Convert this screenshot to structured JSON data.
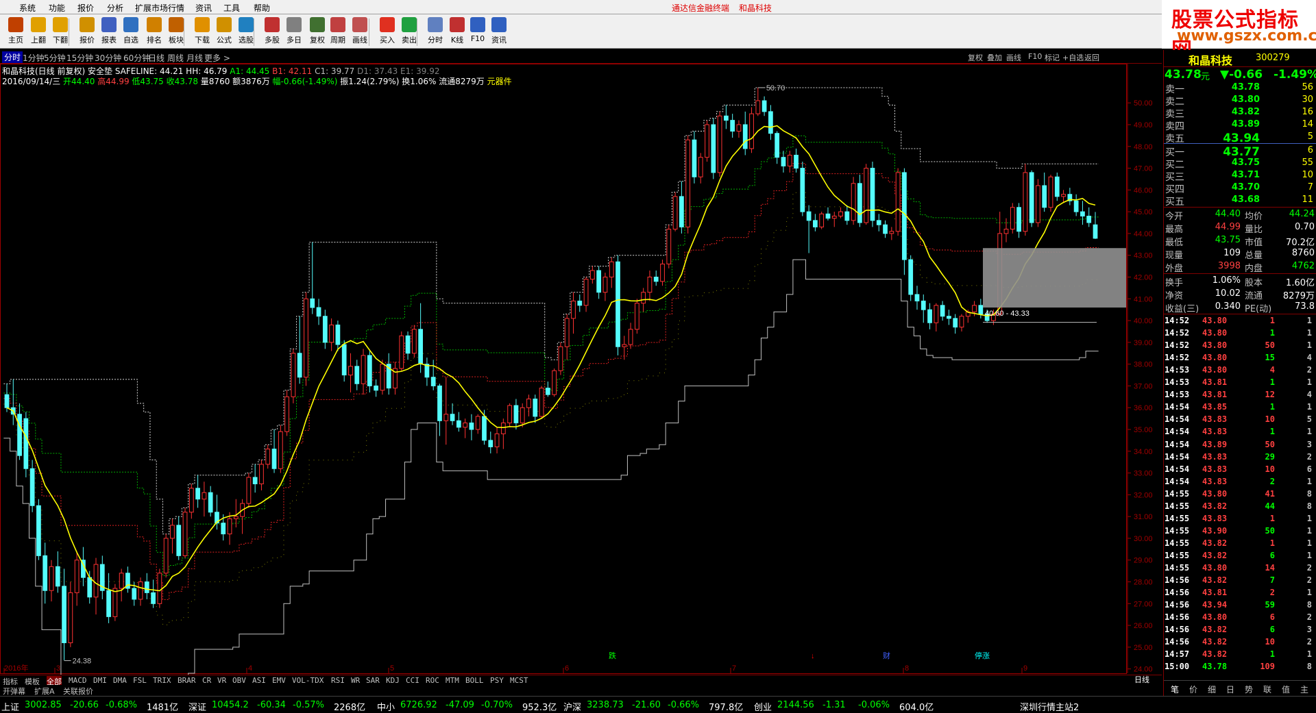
{
  "menu": {
    "items": [
      "系统",
      "功能",
      "报价",
      "分析",
      "扩展市场行情",
      "资讯",
      "工具",
      "帮助"
    ],
    "title_left": "通达信金融终端",
    "title_right": "和晶科技"
  },
  "toolbar": {
    "buttons": [
      "主页",
      "上翻",
      "下翻",
      "报价",
      "报表",
      "自选",
      "排名",
      "板块",
      "下载",
      "公式",
      "选股",
      "多股",
      "多日",
      "复权",
      "周期",
      "画线",
      "买入",
      "卖出",
      "分时",
      "K线",
      "F10",
      "资讯"
    ]
  },
  "logo": {
    "line1": "股票公式指标网",
    "line2": "www.gszx.com.cn"
  },
  "periods": [
    "分时",
    "1分钟",
    "5分钟",
    "15分钟",
    "30分钟",
    "60分钟",
    "日线",
    "周线",
    "月线",
    "更多 >"
  ],
  "right_tools": [
    "复权",
    "叠加",
    "画线",
    "F10",
    "标记",
    "+自选",
    "返回"
  ],
  "info": {
    "line1": [
      "和晶科技(日线 前复权) 安全垫 ",
      "SAFELINE: 44.21",
      "HH: 46.79",
      "A1: 44.45",
      "B1: 42.11",
      "C1: 39.77",
      "D1: 37.43",
      "E1: 39.92"
    ],
    "line2_date": "2016/09/14/三",
    "line2": [
      "开44.40",
      "高44.99",
      "低43.75",
      "收43.78",
      "量8760",
      "额3876万",
      "幅-0.66(-1.49%)",
      "振1.24(2.79%)",
      "换1.06%",
      "流通8279万",
      "元器件"
    ]
  },
  "chart_data": {
    "type": "candlestick",
    "title": "和晶科技(日线 前复权)",
    "ylim": [
      23.8,
      51.8
    ],
    "y_ticks": [
      "50.00",
      "49.00",
      "48.00",
      "47.00",
      "46.00",
      "45.00",
      "44.00",
      "43.00",
      "42.00",
      "41.00",
      "40.00",
      "39.00",
      "38.00",
      "37.00",
      "36.00",
      "35.00",
      "34.00",
      "33.00",
      "32.00",
      "31.00",
      "30.00",
      "29.00",
      "28.00",
      "27.00",
      "26.00",
      "25.00",
      "24.00"
    ],
    "x_labels": [
      "2016年",
      "3",
      "4",
      "5",
      "6",
      "7",
      "8",
      "9"
    ],
    "high_label": "50.70",
    "low_label": "24.38",
    "box_label": "40.60 - 43.33",
    "events": [
      "跌",
      "↓",
      "财",
      "停涨"
    ],
    "ohlc": [
      [
        36.6,
        37.1,
        35.8,
        36.0
      ],
      [
        36.0,
        37.3,
        35.2,
        35.7
      ],
      [
        35.7,
        36.2,
        33.6,
        33.8
      ],
      [
        35.5,
        35.8,
        32.8,
        33.2
      ],
      [
        33.2,
        33.6,
        31.2,
        31.5
      ],
      [
        31.5,
        31.8,
        29.0,
        29.2
      ],
      [
        29.2,
        29.8,
        27.0,
        27.6
      ],
      [
        27.6,
        29.0,
        27.1,
        28.7
      ],
      [
        28.7,
        29.4,
        27.5,
        27.8
      ],
      [
        27.8,
        28.6,
        24.4,
        25.2
      ],
      [
        25.2,
        28.0,
        25.0,
        27.5
      ],
      [
        27.5,
        29.4,
        26.9,
        29.0
      ],
      [
        29.0,
        29.6,
        27.8,
        28.2
      ],
      [
        28.2,
        28.5,
        27.0,
        27.3
      ],
      [
        27.3,
        29.1,
        26.5,
        28.8
      ],
      [
        28.8,
        29.2,
        27.2,
        27.6
      ],
      [
        27.6,
        28.4,
        26.1,
        26.4
      ],
      [
        26.4,
        27.9,
        26.2,
        27.7
      ],
      [
        27.7,
        28.6,
        27.1,
        28.4
      ],
      [
        28.4,
        28.7,
        27.5,
        27.7
      ],
      [
        27.7,
        28.0,
        26.9,
        27.2
      ],
      [
        27.2,
        28.2,
        26.9,
        28.0
      ],
      [
        28.0,
        28.4,
        27.2,
        27.5
      ],
      [
        27.5,
        28.1,
        26.8,
        27.0
      ],
      [
        27.0,
        28.6,
        26.8,
        28.4
      ],
      [
        28.4,
        30.2,
        28.2,
        30.0
      ],
      [
        30.0,
        30.9,
        29.3,
        30.6
      ],
      [
        30.6,
        31.0,
        29.0,
        29.2
      ],
      [
        29.2,
        31.4,
        29.1,
        31.2
      ],
      [
        31.2,
        32.5,
        30.9,
        32.3
      ],
      [
        32.3,
        32.9,
        31.4,
        31.8
      ],
      [
        31.8,
        32.6,
        31.0,
        32.1
      ],
      [
        32.1,
        32.4,
        31.0,
        31.2
      ],
      [
        31.2,
        32.0,
        30.4,
        30.7
      ],
      [
        30.7,
        31.1,
        29.9,
        30.2
      ],
      [
        30.2,
        31.2,
        29.7,
        30.9
      ],
      [
        30.9,
        31.8,
        30.5,
        31.0
      ],
      [
        31.0,
        31.8,
        30.2,
        31.6
      ],
      [
        31.6,
        33.0,
        31.4,
        32.8
      ],
      [
        32.8,
        33.4,
        32.1,
        32.5
      ],
      [
        32.5,
        33.6,
        32.2,
        33.4
      ],
      [
        33.4,
        34.3,
        33.2,
        34.1
      ],
      [
        34.1,
        35.0,
        33.0,
        33.2
      ],
      [
        33.2,
        35.2,
        33.0,
        34.9
      ],
      [
        34.9,
        36.8,
        34.7,
        36.5
      ],
      [
        36.5,
        38.7,
        36.2,
        38.5
      ],
      [
        38.5,
        40.2,
        37.1,
        37.4
      ],
      [
        37.4,
        41.3,
        37.0,
        41.0
      ],
      [
        41.0,
        43.6,
        40.3,
        40.6
      ],
      [
        40.6,
        41.0,
        39.8,
        40.2
      ],
      [
        40.2,
        40.5,
        38.7,
        39.0
      ],
      [
        39.0,
        40.1,
        38.6,
        39.8
      ],
      [
        39.8,
        40.0,
        38.6,
        38.9
      ],
      [
        38.9,
        39.1,
        37.2,
        37.5
      ],
      [
        37.5,
        38.5,
        36.7,
        37.9
      ],
      [
        37.9,
        38.2,
        36.8,
        37.1
      ],
      [
        37.1,
        38.7,
        36.6,
        38.4
      ],
      [
        38.4,
        38.6,
        36.7,
        37.0
      ],
      [
        37.0,
        37.3,
        36.5,
        36.8
      ],
      [
        36.8,
        38.2,
        36.6,
        38.0
      ],
      [
        38.0,
        38.5,
        36.6,
        36.9
      ],
      [
        36.9,
        38.1,
        36.6,
        37.8
      ],
      [
        37.8,
        39.5,
        37.7,
        39.3
      ],
      [
        39.3,
        39.5,
        38.2,
        38.5
      ],
      [
        38.5,
        39.8,
        38.3,
        39.6
      ],
      [
        39.6,
        40.8,
        37.6,
        38.0
      ],
      [
        38.0,
        38.3,
        37.0,
        37.4
      ],
      [
        37.4,
        38.2,
        36.8,
        37.0
      ],
      [
        37.0,
        37.1,
        34.7,
        35.4
      ],
      [
        35.4,
        37.4,
        34.3,
        35.7
      ],
      [
        35.7,
        36.2,
        35.2,
        35.4
      ],
      [
        35.4,
        35.8,
        34.9,
        35.1
      ],
      [
        35.1,
        35.5,
        34.6,
        35.3
      ],
      [
        35.3,
        35.7,
        34.5,
        35.0
      ],
      [
        35.0,
        35.7,
        34.8,
        35.6
      ],
      [
        35.6,
        35.9,
        34.3,
        34.5
      ],
      [
        34.5,
        34.9,
        33.9,
        34.2
      ],
      [
        34.2,
        35.1,
        33.9,
        34.8
      ],
      [
        34.8,
        35.5,
        34.1,
        35.3
      ],
      [
        35.3,
        36.2,
        35.1,
        36.1
      ],
      [
        36.1,
        36.4,
        35.0,
        35.3
      ],
      [
        35.3,
        36.2,
        35.1,
        36.0
      ],
      [
        36.0,
        36.6,
        35.6,
        36.4
      ],
      [
        36.4,
        36.6,
        35.3,
        35.6
      ],
      [
        35.6,
        37.0,
        35.5,
        36.9
      ],
      [
        36.9,
        37.2,
        36.5,
        36.6
      ],
      [
        36.6,
        37.8,
        36.5,
        37.7
      ],
      [
        37.7,
        39.0,
        37.5,
        38.8
      ],
      [
        38.8,
        40.3,
        38.2,
        40.1
      ],
      [
        40.1,
        41.3,
        39.4,
        40.9
      ],
      [
        40.9,
        41.2,
        40.4,
        40.7
      ],
      [
        40.7,
        42.0,
        40.4,
        41.9
      ],
      [
        41.9,
        42.5,
        41.7,
        42.3
      ],
      [
        42.3,
        42.5,
        41.0,
        41.3
      ],
      [
        41.3,
        42.2,
        40.9,
        42.0
      ],
      [
        42.0,
        42.9,
        41.5,
        42.7
      ],
      [
        42.7,
        43.0,
        38.4,
        38.8
      ],
      [
        38.8,
        39.3,
        38.2,
        38.9
      ],
      [
        38.9,
        39.9,
        38.7,
        39.6
      ],
      [
        39.6,
        41.0,
        39.4,
        40.8
      ],
      [
        40.8,
        41.5,
        40.4,
        41.3
      ],
      [
        41.3,
        42.3,
        40.9,
        42.0
      ],
      [
        42.0,
        42.3,
        41.6,
        41.8
      ],
      [
        41.8,
        42.8,
        41.6,
        42.6
      ],
      [
        42.6,
        44.4,
        42.4,
        44.2
      ],
      [
        44.2,
        45.9,
        44.1,
        45.7
      ],
      [
        45.7,
        46.4,
        44.0,
        44.3
      ],
      [
        44.3,
        48.5,
        44.0,
        48.3
      ],
      [
        48.3,
        48.7,
        46.3,
        46.6
      ],
      [
        46.6,
        47.7,
        46.3,
        47.5
      ],
      [
        47.5,
        49.2,
        47.3,
        49.0
      ],
      [
        49.0,
        49.3,
        46.5,
        46.8
      ],
      [
        46.8,
        49.6,
        46.6,
        49.4
      ],
      [
        49.4,
        49.9,
        48.8,
        49.2
      ],
      [
        49.2,
        49.5,
        48.4,
        48.7
      ],
      [
        48.7,
        49.2,
        48.4,
        49.0
      ],
      [
        49.0,
        49.6,
        47.6,
        47.9
      ],
      [
        47.9,
        49.8,
        47.7,
        49.5
      ],
      [
        49.5,
        50.7,
        49.4,
        50.1
      ],
      [
        50.1,
        50.3,
        49.4,
        49.6
      ],
      [
        49.6,
        49.9,
        48.3,
        48.6
      ],
      [
        48.6,
        48.7,
        47.2,
        47.5
      ],
      [
        47.5,
        47.8,
        46.8,
        47.1
      ],
      [
        47.1,
        47.8,
        46.8,
        47.6
      ],
      [
        47.6,
        47.9,
        46.8,
        47.0
      ],
      [
        47.0,
        47.3,
        44.8,
        45.0
      ],
      [
        45.0,
        45.3,
        43.1,
        44.6
      ],
      [
        44.6,
        44.9,
        44.1,
        44.3
      ],
      [
        44.3,
        45.0,
        44.2,
        44.9
      ],
      [
        44.9,
        45.2,
        44.6,
        44.7
      ],
      [
        44.7,
        45.0,
        44.3,
        44.8
      ],
      [
        44.8,
        45.2,
        44.7,
        45.0
      ],
      [
        45.0,
        45.3,
        44.4,
        44.6
      ],
      [
        44.6,
        46.6,
        44.4,
        46.3
      ],
      [
        46.3,
        46.7,
        44.3,
        44.5
      ],
      [
        44.5,
        47.2,
        44.4,
        47.0
      ],
      [
        47.0,
        47.3,
        44.3,
        44.6
      ],
      [
        44.6,
        44.9,
        44.1,
        44.4
      ],
      [
        44.4,
        44.6,
        43.8,
        44.0
      ],
      [
        44.0,
        44.3,
        43.7,
        44.1
      ],
      [
        44.1,
        47.0,
        43.9,
        46.8
      ],
      [
        46.8,
        47.0,
        42.1,
        42.8
      ],
      [
        42.8,
        43.0,
        40.9,
        41.2
      ],
      [
        41.2,
        41.6,
        40.5,
        40.9
      ],
      [
        40.9,
        41.2,
        39.9,
        40.5
      ],
      [
        40.5,
        40.8,
        39.6,
        39.9
      ],
      [
        39.9,
        40.8,
        39.5,
        40.7
      ],
      [
        40.7,
        40.9,
        40.0,
        40.2
      ],
      [
        40.2,
        40.5,
        39.8,
        40.1
      ],
      [
        40.1,
        40.3,
        39.4,
        39.7
      ],
      [
        39.7,
        40.3,
        39.5,
        40.2
      ],
      [
        40.2,
        40.5,
        39.9,
        40.4
      ],
      [
        40.4,
        40.9,
        40.2,
        40.7
      ],
      [
        40.7,
        41.0,
        40.1,
        40.3
      ],
      [
        40.3,
        40.5,
        39.9,
        40.0
      ],
      [
        40.0,
        40.5,
        39.8,
        40.3
      ],
      [
        40.3,
        45.0,
        40.2,
        44.0
      ],
      [
        44.0,
        44.7,
        43.6,
        44.2
      ],
      [
        44.2,
        45.4,
        44.0,
        45.2
      ],
      [
        45.2,
        45.4,
        43.8,
        44.1
      ],
      [
        44.1,
        47.2,
        43.9,
        46.8
      ],
      [
        46.8,
        46.9,
        44.3,
        44.5
      ],
      [
        44.5,
        46.5,
        44.3,
        46.2
      ],
      [
        46.2,
        46.8,
        45.0,
        45.2
      ],
      [
        45.2,
        46.7,
        45.0,
        46.6
      ],
      [
        46.6,
        46.8,
        45.5,
        45.7
      ],
      [
        45.7,
        46.0,
        45.4,
        45.8
      ],
      [
        45.8,
        46.1,
        45.3,
        45.5
      ],
      [
        45.5,
        45.8,
        44.8,
        45.0
      ],
      [
        45.0,
        45.5,
        44.4,
        44.8
      ],
      [
        44.8,
        45.2,
        44.3,
        44.5
      ],
      [
        44.4,
        44.99,
        43.75,
        43.78
      ]
    ]
  },
  "quote": {
    "name": "和晶科技",
    "code": "300279",
    "price": "43.78",
    "unit": "元",
    "change": "▼-0.66",
    "pct": "-1.49%",
    "asks": [
      {
        "label": "卖五",
        "price": "43.94",
        "vol": "5"
      },
      {
        "label": "卖四",
        "price": "43.89",
        "vol": "14"
      },
      {
        "label": "卖三",
        "price": "43.82",
        "vol": "16"
      },
      {
        "label": "卖二",
        "price": "43.80",
        "vol": "30"
      },
      {
        "label": "卖一",
        "price": "43.78",
        "vol": "56"
      }
    ],
    "bids": [
      {
        "label": "买一",
        "price": "43.77",
        "vol": "6"
      },
      {
        "label": "买二",
        "price": "43.75",
        "vol": "55"
      },
      {
        "label": "买三",
        "price": "43.71",
        "vol": "10"
      },
      {
        "label": "买四",
        "price": "43.70",
        "vol": "7"
      },
      {
        "label": "买五",
        "price": "43.68",
        "vol": "11"
      }
    ],
    "stats": [
      {
        "l1": "今开",
        "v1": "44.40",
        "l2": "均价",
        "v2": "44.24"
      },
      {
        "l1": "最高",
        "v1": "44.99",
        "l2": "量比",
        "v2": "0.70"
      },
      {
        "l1": "最低",
        "v1": "43.75",
        "l2": "市值",
        "v2": "70.2亿"
      },
      {
        "l1": "现量",
        "v1": "109",
        "l2": "总量",
        "v2": "8760"
      },
      {
        "l1": "外盘",
        "v1": "3998",
        "l2": "内盘",
        "v2": "4762"
      },
      {
        "l1": "换手",
        "v1": "1.06%",
        "l2": "股本",
        "v2": "1.60亿"
      },
      {
        "l1": "净资",
        "v1": "10.02",
        "l2": "流通",
        "v2": "8279万"
      },
      {
        "l1": "收益(三)",
        "v1": "0.340",
        "l2": "PE(动)",
        "v2": "73.8"
      }
    ],
    "ticks": [
      [
        "14:52",
        "43.80",
        "1",
        "1"
      ],
      [
        "14:52",
        "43.80",
        "1",
        "1"
      ],
      [
        "14:52",
        "43.80",
        "50",
        "1"
      ],
      [
        "14:52",
        "43.80",
        "15",
        "4"
      ],
      [
        "14:53",
        "43.80",
        "4",
        "2"
      ],
      [
        "14:53",
        "43.81",
        "1",
        "1"
      ],
      [
        "14:53",
        "43.81",
        "12",
        "4"
      ],
      [
        "14:54",
        "43.85",
        "1",
        "1"
      ],
      [
        "14:54",
        "43.83",
        "10",
        "5"
      ],
      [
        "14:54",
        "43.83",
        "1",
        "1"
      ],
      [
        "14:54",
        "43.89",
        "50",
        "3"
      ],
      [
        "14:54",
        "43.83",
        "29",
        "2"
      ],
      [
        "14:54",
        "43.83",
        "10",
        "6"
      ],
      [
        "14:54",
        "43.83",
        "2",
        "1"
      ],
      [
        "14:55",
        "43.80",
        "41",
        "8"
      ],
      [
        "14:55",
        "43.82",
        "44",
        "8"
      ],
      [
        "14:55",
        "43.83",
        "1",
        "1"
      ],
      [
        "14:55",
        "43.90",
        "50",
        "1"
      ],
      [
        "14:55",
        "43.82",
        "1",
        "1"
      ],
      [
        "14:55",
        "43.82",
        "6",
        "1"
      ],
      [
        "14:55",
        "43.80",
        "14",
        "2"
      ],
      [
        "14:56",
        "43.82",
        "7",
        "2"
      ],
      [
        "14:56",
        "43.81",
        "2",
        "1"
      ],
      [
        "14:56",
        "43.94",
        "59",
        "8"
      ],
      [
        "14:56",
        "43.80",
        "6",
        "2"
      ],
      [
        "14:56",
        "43.82",
        "6",
        "3"
      ],
      [
        "14:56",
        "43.82",
        "10",
        "2"
      ],
      [
        "14:57",
        "43.82",
        "1",
        "1"
      ],
      [
        "15:00",
        "43.78",
        "109",
        "8"
      ]
    ],
    "tabs": [
      "笔",
      "价",
      "细",
      "日",
      "势",
      "联",
      "值",
      "主"
    ]
  },
  "indicator_tabs": [
    "指标",
    "模板",
    "全部",
    "MACD",
    "DMI",
    "DMA",
    "FSL",
    "TRIX",
    "BRAR",
    "CR",
    "VR",
    "OBV",
    "ASI",
    "EMV",
    "VOL-TDX",
    "RSI",
    "WR",
    "SAR",
    "KDJ",
    "CCI",
    "ROC",
    "MTM",
    "BOLL",
    "PSY",
    "MCST"
  ],
  "ext_tabs": [
    "开弹幕",
    "扩展A",
    "关联报价"
  ],
  "right_label": "日线",
  "status": [
    {
      "name": "上证",
      "val": "3002.85",
      "chg": "-20.66",
      "pct": "-0.68%",
      "amt": "1481亿"
    },
    {
      "name": "深证",
      "val": "10454.2",
      "chg": "-60.34",
      "pct": "-0.57%",
      "amt": "2268亿"
    },
    {
      "name": "中小",
      "val": "6726.92",
      "chg": "-47.09",
      "pct": "-0.70%",
      "amt": "952.3亿"
    },
    {
      "name": "沪深",
      "val": "3238.73",
      "chg": "-21.60",
      "pct": "-0.66%",
      "amt": "797.8亿"
    },
    {
      "name": "创业",
      "val": "2144.56",
      "chg": "-1.31",
      "pct": "-0.06%",
      "amt": "604.0亿"
    }
  ],
  "server": "深圳行情主站2",
  "colors": {
    "up": "#ff3232",
    "down": "#54fcfc",
    "ma": "#ffff00",
    "bg": "#000000"
  }
}
